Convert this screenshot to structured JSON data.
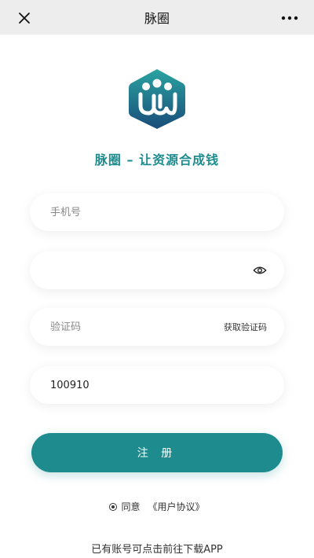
{
  "header": {
    "title": "脉圈"
  },
  "slogan": "脉圈 – 让资源合成钱",
  "form": {
    "phone_placeholder": "手机号",
    "password_value": "",
    "code_placeholder": "验证码",
    "get_code_label": "获取验证码",
    "invite_value": "100910"
  },
  "register_label": "注 册",
  "agreement": {
    "agree_label": "同意",
    "link_label": "《用户协议》"
  },
  "download_text": "已有账号可点击前往下载APP",
  "colors": {
    "accent": "#1e8c8e",
    "logo_dark": "#1a4d7a",
    "logo_light": "#2aa3a0",
    "topbar_bg": "#ededed"
  },
  "icons": {
    "close": "close-icon",
    "more": "more-icon",
    "eye": "eye-icon",
    "radio": "radio-icon"
  }
}
